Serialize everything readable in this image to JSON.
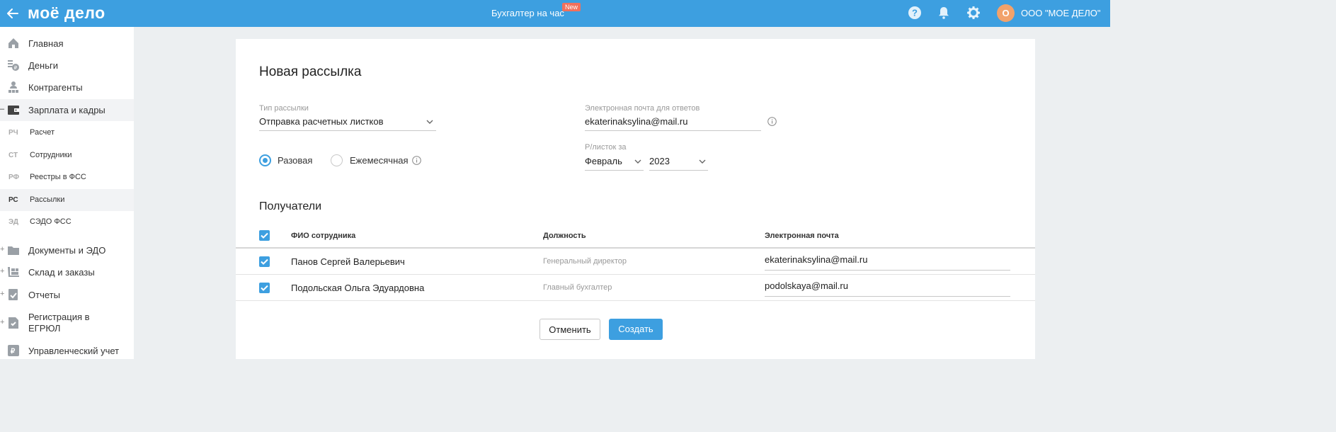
{
  "header": {
    "logo": "моё дело",
    "center_title": "Бухгалтер на час",
    "new_badge": "New",
    "avatar_letter": "О",
    "company": "ООО \"МОЕ ДЕЛО\"",
    "icons": [
      "back-arrow-icon",
      "help-icon",
      "bell-icon",
      "gear-icon"
    ]
  },
  "sidebar": {
    "items": [
      {
        "label": "Главная",
        "icon": "home-icon"
      },
      {
        "label": "Деньги",
        "icon": "money-icon"
      },
      {
        "label": "Контрагенты",
        "icon": "contractors-icon"
      },
      {
        "label": "Зарплата и кадры",
        "icon": "wallet-icon"
      }
    ],
    "subitems": [
      {
        "abbr": "РЧ",
        "label": "Расчет"
      },
      {
        "abbr": "СТ",
        "label": "Сотрудники"
      },
      {
        "abbr": "РФ",
        "label": "Реестры в ФСС"
      },
      {
        "abbr": "РС",
        "label": "Рассылки"
      },
      {
        "abbr": "ЭД",
        "label": "СЭДО ФСС"
      }
    ],
    "items2": [
      {
        "label": "Документы и ЭДО",
        "icon": "folder-icon"
      },
      {
        "label": "Склад и заказы",
        "icon": "warehouse-icon"
      },
      {
        "label": "Отчеты",
        "icon": "reports-icon"
      },
      {
        "label": "Регистрация в ЕГРЮЛ",
        "icon": "registration-icon"
      },
      {
        "label": "Управленческий учет",
        "icon": "management-icon"
      }
    ]
  },
  "form": {
    "title": "Новая рассылка",
    "type_label": "Тип рассылки",
    "type_value": "Отправка расчетных листков",
    "email_label": "Электронная почта для ответов",
    "email_value": "ekaterinaksylina@mail.ru",
    "radio_once": "Разовая",
    "radio_monthly": "Ежемесячная",
    "period_label": "Р/листок за",
    "month_value": "Февраль",
    "year_value": "2023"
  },
  "recipients": {
    "title": "Получатели",
    "headers": {
      "name": "ФИО сотрудника",
      "position": "Должность",
      "email": "Электронная почта"
    },
    "rows": [
      {
        "name": "Панов Сергей Валерьевич",
        "position": "Генеральный директор",
        "email": "ekaterinaksylina@mail.ru"
      },
      {
        "name": "Подольская Ольга Эдуардовна",
        "position": "Главный бухгалтер",
        "email": "podolskaya@mail.ru"
      }
    ]
  },
  "buttons": {
    "cancel": "Отменить",
    "create": "Создать"
  },
  "colors": {
    "accent": "#3d9fe0",
    "badge": "#f2705c",
    "avatar": "#f2a26b"
  }
}
